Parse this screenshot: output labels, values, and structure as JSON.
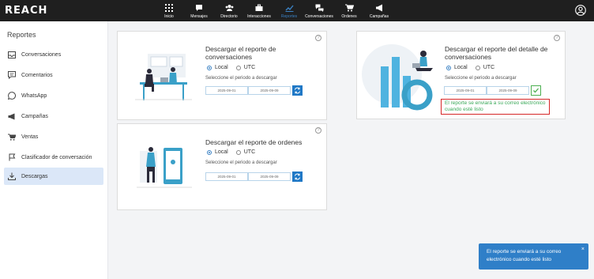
{
  "app": {
    "logo": "REACH"
  },
  "nav": [
    {
      "label": "Inicio",
      "icon": "grid-icon"
    },
    {
      "label": "Mensajes",
      "icon": "chat-icon"
    },
    {
      "label": "Directorio",
      "icon": "contacts-icon"
    },
    {
      "label": "Interacciones",
      "icon": "briefcase-icon"
    },
    {
      "label": "Reportes",
      "icon": "chart-icon",
      "active": true
    },
    {
      "label": "Conversaciones",
      "icon": "conversations-icon"
    },
    {
      "label": "Ordenes",
      "icon": "cart-icon"
    },
    {
      "label": "Campañas",
      "icon": "megaphone-icon"
    }
  ],
  "sidebar": {
    "title": "Reportes",
    "items": [
      {
        "label": "Conversaciones",
        "icon": "inbox-icon"
      },
      {
        "label": "Comentarios",
        "icon": "comment-icon"
      },
      {
        "label": "WhatsApp",
        "icon": "whatsapp-icon"
      },
      {
        "label": "Campañas",
        "icon": "megaphone-icon"
      },
      {
        "label": "Ventas",
        "icon": "cart-icon"
      },
      {
        "label": "Clasificador de conversación",
        "icon": "flag-icon"
      },
      {
        "label": "Descargas",
        "icon": "download-icon",
        "active": true
      }
    ]
  },
  "cards": {
    "conversaciones": {
      "title_line1": "Descargar el reporte de",
      "title_line2": "conversaciones",
      "radio_local": "Local",
      "radio_utc": "UTC",
      "period_label": "Seleccione el periodo a descargar",
      "date_from": "2025-09-01",
      "date_to": "2025-09-09"
    },
    "detalle": {
      "title_line1": "Descargar el reporte del detalle de",
      "title_line2": "conversaciones",
      "radio_local": "Local",
      "radio_utc": "UTC",
      "period_label": "Seleccione el periodo a descargar",
      "date_from": "2025-09-01",
      "date_to": "2025-09-09",
      "notice": "El reporte se enviará a su correo electrónico cuando esté listo"
    },
    "ordenes": {
      "title": "Descargar el reporte de ordenes",
      "radio_local": "Local",
      "radio_utc": "UTC",
      "period_label": "Seleccione el periodo a descargar",
      "date_from": "2025-09-01",
      "date_to": "2025-09-09"
    }
  },
  "help_glyph": "?",
  "toast": {
    "message": "El reporte se enviará a su correo electrónico cuando esté listo",
    "close": "×"
  },
  "colors": {
    "topbar": "#1f1f1f",
    "accent": "#2f7fc8",
    "success": "#3aaa5a",
    "highlight": "#d62728"
  }
}
